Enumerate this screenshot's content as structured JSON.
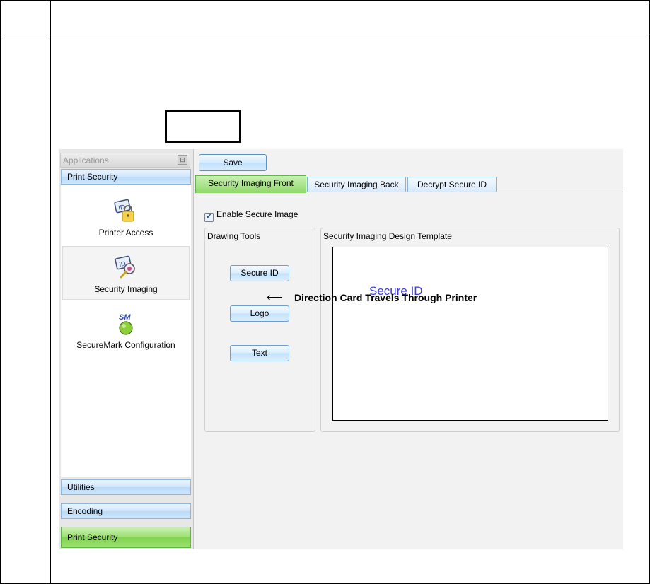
{
  "nav": {
    "header": "Applications",
    "top_group": "Print Security",
    "apps": [
      {
        "label": "Printer Access",
        "icon": "lock-card-icon"
      },
      {
        "label": "Security Imaging",
        "icon": "magnifier-card-icon"
      },
      {
        "label": "SecureMark Configuration",
        "icon": "sm-green-dot-icon",
        "icon_text": "SM"
      }
    ],
    "bottom_groups": [
      "Utilities",
      "Encoding",
      "Print Security"
    ]
  },
  "toolbar": {
    "save_label": "Save"
  },
  "tabs": [
    "Security Imaging Front",
    "Security Imaging Back",
    "Decrypt Secure ID"
  ],
  "enable_secure_image": {
    "label": "Enable Secure Image",
    "checked": true
  },
  "drawing_tools": {
    "title": "Drawing Tools",
    "buttons": [
      "Secure ID",
      "Logo",
      "Text"
    ]
  },
  "template": {
    "title": "Security Imaging Design Template",
    "card_text": "Secure ID"
  },
  "direction_note": "Direction Card Travels Through Printer",
  "colors": {
    "active_green": "#8fd968",
    "blue_button": "#c3e1fb",
    "card_text": "#3b3bdb"
  }
}
